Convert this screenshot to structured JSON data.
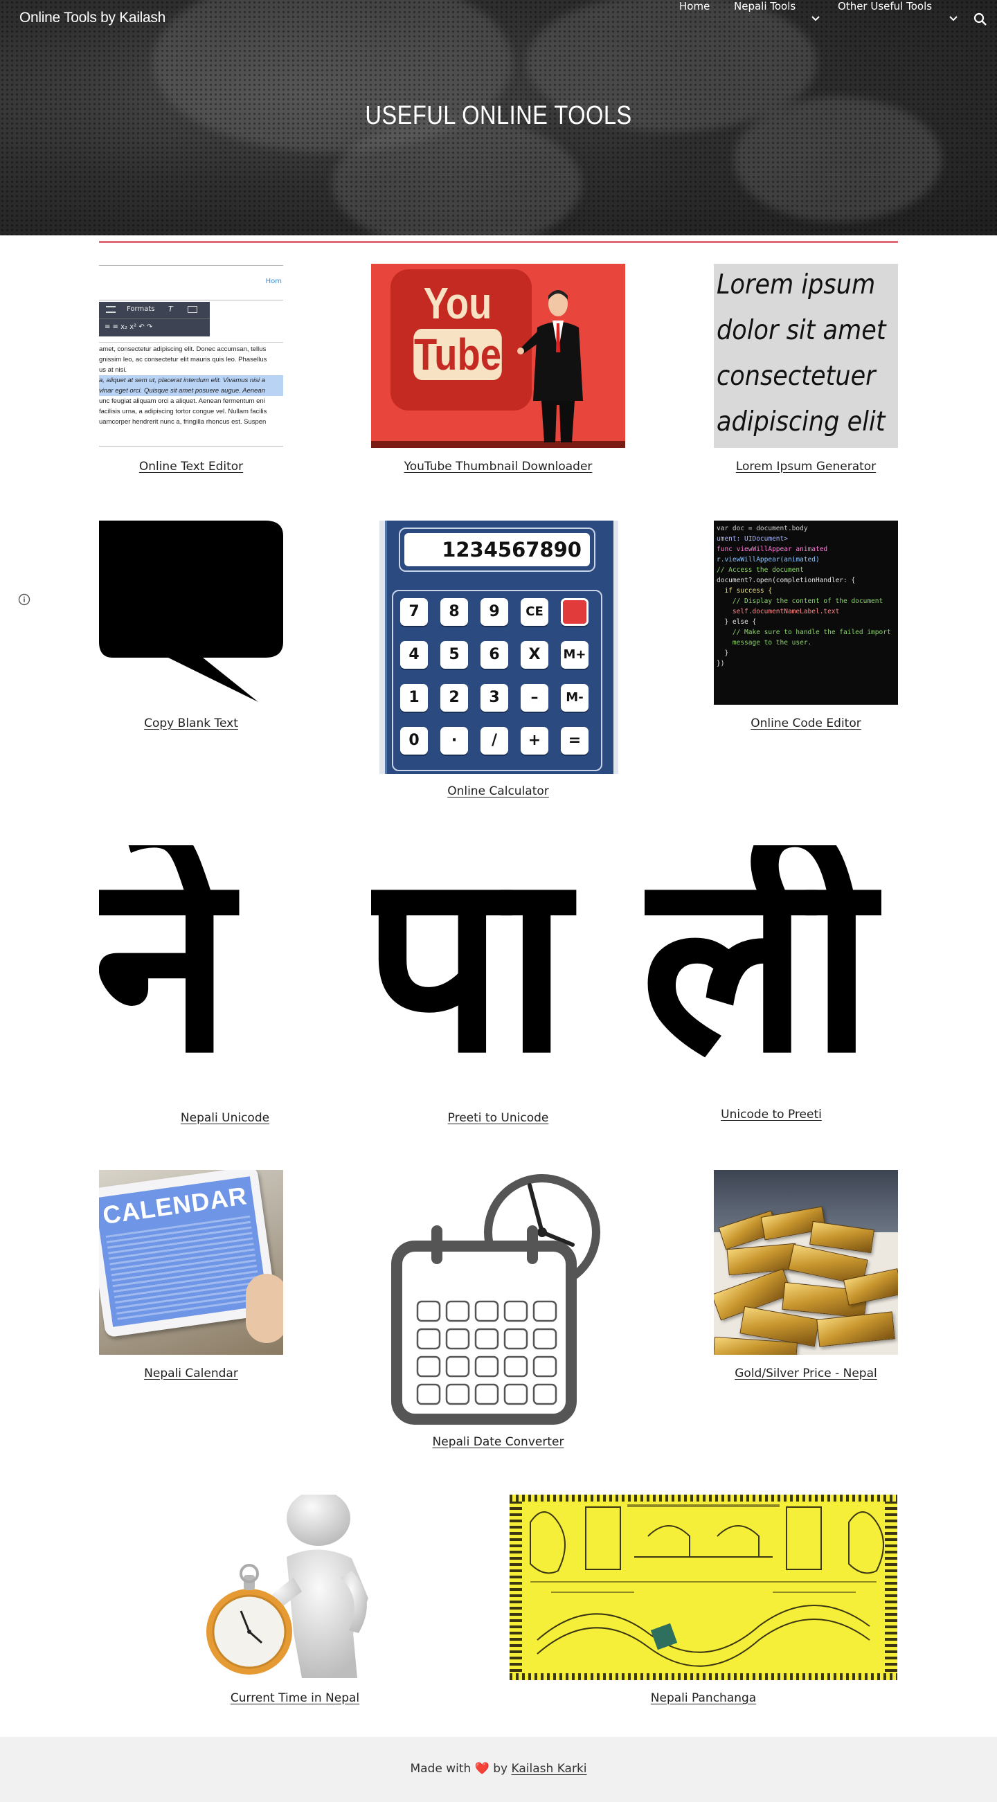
{
  "site": {
    "title": "Online Tools by Kailash",
    "hero_title": "USEFUL ONLINE TOOLS"
  },
  "nav": {
    "home": "Home",
    "nepali_tools": "Nepali Tools",
    "other_tools": "Other Useful Tools"
  },
  "tiles": {
    "text_editor": {
      "label": "Online Text Editor",
      "toolbar_formats": "Formats",
      "home_link": "Hom",
      "sample_lines": [
        "amet, consectetur adipiscing elit. Donec accumsan, tellus",
        "gnissim leo, ac consectetur elit mauris quis leo. Phasellus",
        "us at nisi.",
        "a, aliquet at sem ut, placerat interdum elit. Vivamus nisi a",
        "vinar eget orci. Quisque sit amet posuere augue. Aenean",
        "unc feugiat aliquam orci a aliquet. Aenean fermentum eni",
        "facilisis urna, a adipiscing tortor congue vel. Nullam facilis",
        "uamcorper hendrerit nunc a, fringilla rhoncus est. Suspen"
      ]
    },
    "yt_thumb": {
      "label": "YouTube Thumbnail Downloader",
      "logo_top": "You",
      "logo_bottom": "Tube"
    },
    "lorem": {
      "label": "Lorem Ipsum Generator",
      "lines": [
        "Lorem ipsum",
        "dolor sit amet",
        "consectetuer",
        "adipiscing elit"
      ]
    },
    "blank": {
      "label": "Copy Blank Text"
    },
    "calculator": {
      "label": "Online Calculator",
      "display": "1234567890",
      "keys": [
        "7",
        "8",
        "9",
        "CE",
        "",
        "4",
        "5",
        "6",
        "X",
        "M+",
        "1",
        "2",
        "3",
        "–",
        "M-",
        "0",
        "·",
        "/",
        "+",
        "="
      ]
    },
    "code_editor": {
      "label": "Online Code Editor",
      "lines": [
        "var doc = document.body",
        "ument: UIDocument>",
        "",
        "func viewWillAppear animated",
        "r.viewWillAppear(animated)",
        "",
        "// Access the document",
        "document?.open(completionHandler: {",
        "  if success {",
        "    // Display the content of the document",
        "    self.documentNameLabel.text",
        "  } else {",
        "    // Make sure to handle the failed import",
        "    message to the user.",
        "  }",
        "})"
      ]
    },
    "nepali_unicode": {
      "label": "Nepali Unicode",
      "glyph": "ने"
    },
    "preeti": {
      "label": "Preeti to Unicode",
      "glyph": "पा"
    },
    "unicode_preeti": {
      "label": "Unicode to Preeti",
      "glyph": "ली"
    },
    "calendar": {
      "label": "Nepali Calendar",
      "word": "CALENDAR"
    },
    "date_converter": {
      "label": "Nepali Date Converter"
    },
    "gold": {
      "label": "Gold/Silver Price - Nepal"
    },
    "current_time": {
      "label": "Current Time in Nepal"
    },
    "panchanga": {
      "label": "Nepali Panchanga"
    }
  },
  "footer": {
    "made_with": "Made with",
    "by": "by",
    "heart": "❤️",
    "author": "Kailash Karki"
  },
  "colors": {
    "accent_divider": "#e06a76",
    "youtube_red": "#e8453c",
    "calc_blue": "#2b4a7f",
    "panchanga_yellow": "#f5ef3a"
  }
}
